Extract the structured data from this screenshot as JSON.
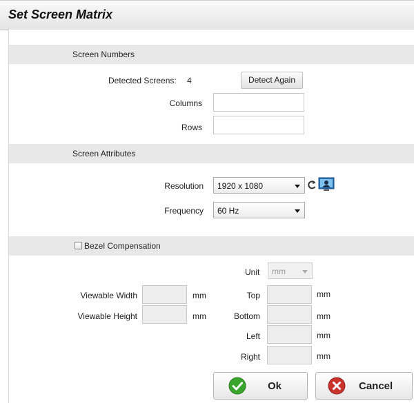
{
  "dialog": {
    "title": "Set Screen Matrix"
  },
  "screen_numbers": {
    "heading": "Screen Numbers",
    "detected_label": "Detected Screens:",
    "detected_count": "4",
    "detect_again_label": "Detect Again",
    "columns_label": "Columns",
    "columns_value": "",
    "rows_label": "Rows",
    "rows_value": ""
  },
  "screen_attributes": {
    "heading": "Screen Attributes",
    "resolution_label": "Resolution",
    "resolution_value": "1920 x 1080",
    "frequency_label": "Frequency",
    "frequency_value": "60 Hz"
  },
  "bezel": {
    "checkbox_label": "Bezel Compensation",
    "checked": false,
    "unit_label": "Unit",
    "unit_value": "mm",
    "viewable_width_label": "Viewable Width",
    "viewable_height_label": "Viewable Height",
    "top_label": "Top",
    "bottom_label": "Bottom",
    "left_label": "Left",
    "right_label": "Right",
    "mm": "mm"
  },
  "actions": {
    "ok_label": "Ok",
    "cancel_label": "Cancel"
  },
  "colors": {
    "ok_green": "#3aa52c",
    "cancel_red": "#c8332c",
    "monitor_blue": "#2b6fb3"
  }
}
